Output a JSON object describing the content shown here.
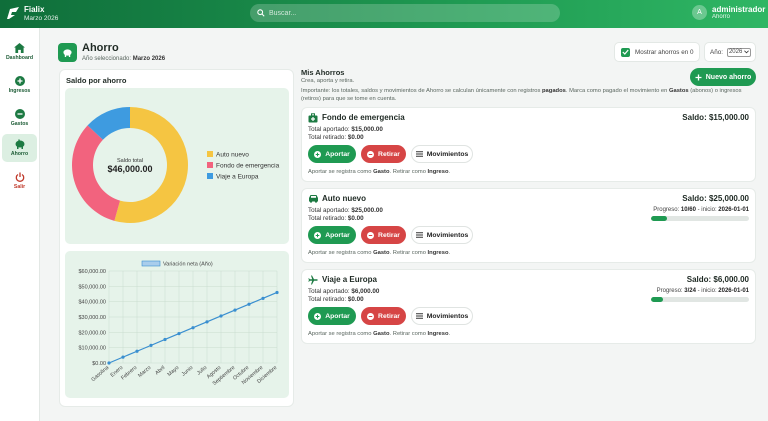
{
  "app": {
    "name": "Fialix",
    "period": "Marzo 2026"
  },
  "search": {
    "placeholder": "Buscar..."
  },
  "user": {
    "initial": "A",
    "name": "administrador",
    "section": "Ahorro"
  },
  "sidebar": {
    "items": [
      {
        "label": "Dashboard",
        "icon": "home-icon"
      },
      {
        "label": "Ingresos",
        "icon": "plus-circle-icon"
      },
      {
        "label": "Gastos",
        "icon": "minus-circle-icon"
      },
      {
        "label": "Ahorro",
        "icon": "piggy-bank-icon",
        "active": true
      },
      {
        "label": "Salir",
        "icon": "power-icon"
      }
    ]
  },
  "page": {
    "title": "Ahorro",
    "selected_label": "Año seleccionado:",
    "selected_value": "Marzo 2026",
    "show_zero_label": "Mostrar ahorros en 0",
    "show_zero_checked": true,
    "year_label": "Año:",
    "year_value": "2026"
  },
  "saldo_panel": {
    "title": "Saldo por ahorro"
  },
  "donut": {
    "center_label": "Saldo total",
    "center_value": "$46,000.00"
  },
  "mis_ahorros": {
    "title": "Mis Ahorros",
    "subtitle": "Crea, aporta y retira.",
    "note_part1": "Importante: los totales, saldos y movimientos de Ahorro se calculan únicamente con registros ",
    "note_bold1": "pagados",
    "note_part2": ". Marca como pagado el movimiento en ",
    "note_bold2": "Gastos",
    "note_part3": " (abonos) o ingresos (retiros) para que se tome en cuenta.",
    "new_button": "Nuevo ahorro"
  },
  "cards": [
    {
      "name": "Fondo de emergencia",
      "icon": "medkit-icon",
      "saldo": "Saldo: $15,000.00",
      "aportado_label": "Total aportado:",
      "aportado": "$15,000.00",
      "retirado_label": "Total retirado:",
      "retirado": "$0.00",
      "progress": null
    },
    {
      "name": "Auto nuevo",
      "icon": "car-icon",
      "saldo": "Saldo: $25,000.00",
      "aportado_label": "Total aportado:",
      "aportado": "$25,000.00",
      "retirado_label": "Total retirado:",
      "retirado": "$0.00",
      "progress": {
        "label": "Progreso:",
        "value": "10/60",
        "inicio_label": "- inicio:",
        "inicio": "2026-01-01",
        "fraction": 0.1667
      }
    },
    {
      "name": "Viaje a Europa",
      "icon": "plane-icon",
      "saldo": "Saldo: $6,000.00",
      "aportado_label": "Total aportado:",
      "aportado": "$6,000.00",
      "retirado_label": "Total retirado:",
      "retirado": "$0.00",
      "progress": {
        "label": "Progreso:",
        "value": "3/24",
        "inicio_label": "- inicio:",
        "inicio": "2026-01-01",
        "fraction": 0.125
      }
    }
  ],
  "card_buttons": {
    "aportar": "Aportar",
    "retirar": "Retirar",
    "movimientos": "Movimientos"
  },
  "card_footer": {
    "part1": "Aportar se registra como ",
    "bold1": "Gasto",
    "part2": ". Retirar como ",
    "bold2": "Ingreso",
    "part3": "."
  },
  "colors": {
    "primary": "#1f9a52",
    "danger": "#d64545",
    "auto": "#f5c542",
    "fondo": "#f2637e",
    "viaje": "#3e9be0"
  },
  "chart_data": [
    {
      "type": "pie",
      "categories": [
        "Auto nuevo",
        "Fondo de emergencia",
        "Viaje a Europa"
      ],
      "values": [
        25000,
        15000,
        6000
      ],
      "colors": [
        "#f5c542",
        "#f2637e",
        "#3e9be0"
      ],
      "legend": "right",
      "donut": true
    },
    {
      "type": "line",
      "series": [
        {
          "name": "Variación neta (Año)",
          "values": [
            0,
            3833.33,
            7666.67,
            11500,
            15333.33,
            19166.67,
            23000,
            26833.33,
            30666.67,
            34500,
            38333.33,
            42166.67,
            46000
          ]
        }
      ],
      "x": [
        "Gasolina",
        "Enero",
        "Febrero",
        "Marzo",
        "Abril",
        "Mayo",
        "Junio",
        "Julio",
        "Agosto",
        "Septiembre",
        "Octubre",
        "Noviembre",
        "Diciembre"
      ],
      "yticks": [
        "$0.00",
        "$10,000.00",
        "$20,000.00",
        "$30,000.00",
        "$40,000.00",
        "$50,000.00",
        "$60,000.00"
      ],
      "ylim": [
        0,
        60000
      ],
      "grid": true,
      "legend": "top"
    }
  ]
}
